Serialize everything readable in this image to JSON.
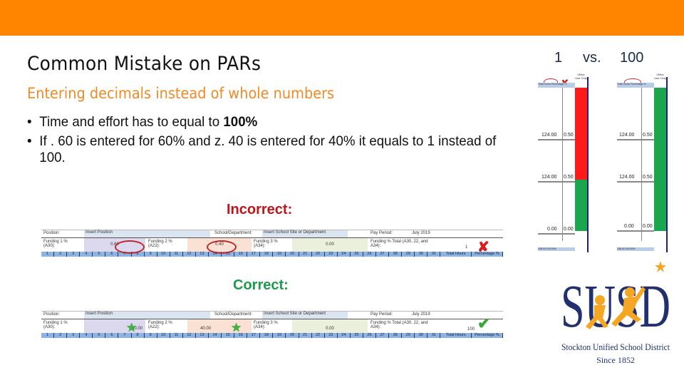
{
  "header": {
    "band_color": "#ff8400"
  },
  "slide": {
    "title": "Common Mistake on PARs",
    "subtitle": "Entering decimals instead of whole numbers",
    "bullets": [
      {
        "text": "Time and effort has to equal to ",
        "bold": "100%"
      },
      {
        "text": "If . 60 is entered for 60% and z. 40 is entered for 40% it equals to 1 instead of 100."
      }
    ],
    "incorrect_label": "Incorrect:",
    "correct_label": "Correct:"
  },
  "incorrect_sheet": {
    "position_label": "Position:",
    "position_value": "Insert Position",
    "school_label": "School/Department:",
    "school_value": "Insert School Site or Department",
    "pay_period_label": "Pay Period:",
    "pay_period_value": "July 2019",
    "funding1_label": "Funding 1 % (A30):",
    "funding1_value": "0.60",
    "funding2_label": "Funding 2 % (A22):",
    "funding2_value": "0.40",
    "funding3_label": "Funding 3 % (A34):",
    "funding3_value": "0.00",
    "total_label": "Funding % Total (A30, 22, and A34):",
    "total_value": "1",
    "days": [
      "1",
      "2",
      "3",
      "4",
      "5",
      "6",
      "7",
      "8",
      "9",
      "10",
      "11",
      "12",
      "13",
      "14",
      "15",
      "16",
      "17",
      "18",
      "19",
      "20",
      "21",
      "22",
      "23",
      "24",
      "25",
      "26",
      "27",
      "28",
      "29",
      "30",
      "31",
      "Total Hours",
      "Percentage %"
    ],
    "status": "incorrect"
  },
  "correct_sheet": {
    "position_label": "Position:",
    "position_value": "Insert Position",
    "school_label": "School/Department:",
    "school_value": "Insert School Site or Department",
    "pay_period_label": "Pay Period:",
    "pay_period_value": "July 2019",
    "funding1_label": "Funding 1 % (A30):",
    "funding1_value": "60.00",
    "funding2_label": "Funding 2 % (A22):",
    "funding2_value": "40.00",
    "funding3_label": "Funding 3 % (A34):",
    "funding3_value": "0.00",
    "total_label": "Funding % Total (A30, 22, and A34):",
    "total_value": "100",
    "days": [
      "1",
      "2",
      "3",
      "4",
      "5",
      "6",
      "7",
      "8",
      "9",
      "10",
      "11",
      "12",
      "13",
      "14",
      "15",
      "16",
      "17",
      "18",
      "19",
      "20",
      "21",
      "22",
      "23",
      "24",
      "25",
      "26",
      "27",
      "28",
      "29",
      "30",
      "31",
      "Total Hours",
      "Percentage %"
    ],
    "status": "correct"
  },
  "comparison": {
    "left_value": "1",
    "vs_label": "vs.",
    "right_value": "100",
    "left_panel": {
      "header": "Total Hours  Percentage %",
      "office_label": "Office Use Only",
      "circled_value": "1",
      "rows": [
        {
          "hours": "124.00",
          "pct": "0.50",
          "flag": "ERROR"
        },
        {
          "hours": "124.00",
          "pct": "0.50",
          "flag": "ERROR"
        },
        {
          "hours": "0.00",
          "pct": "0.00"
        }
      ],
      "totals": {
        "hours": "248.00",
        "pct": "100.00%"
      },
      "colors": [
        "#ff1a1a",
        "#ff1a1a",
        "#1aa64c"
      ]
    },
    "right_panel": {
      "header": "Total Hours  Percentage %",
      "office_label": "Office Use Only",
      "circled_value": "100",
      "rows": [
        {
          "hours": "124.00",
          "pct": "0.50"
        },
        {
          "hours": "124.00",
          "pct": "0.50"
        },
        {
          "hours": "0.00",
          "pct": "0.00"
        }
      ],
      "totals": {
        "hours": "248.00",
        "pct": "100.00%"
      },
      "colors": [
        "#1aa64c",
        "#1aa64c",
        "#1aa64c"
      ]
    }
  },
  "logo": {
    "letters": "SUSD",
    "name": "Stockton Unified School District",
    "since": "Since 1852",
    "navy": "#22306e",
    "orange": "#f5a623"
  }
}
